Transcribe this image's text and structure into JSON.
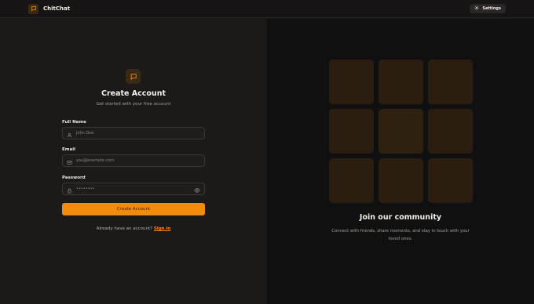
{
  "header": {
    "brand_name": "ChitChat",
    "settings_label": "Settings",
    "brand_icon": "chat-bubble-icon",
    "settings_icon": "gear-icon"
  },
  "form": {
    "title": "Create Account",
    "subtitle": "Get started with your free account",
    "fields": [
      {
        "label": "Full Name",
        "placeholder": "John Doe",
        "icon": "user-icon"
      },
      {
        "label": "Email",
        "placeholder": "you@example.com",
        "icon": "mail-icon"
      },
      {
        "label": "Password",
        "placeholder": "••••••••",
        "icon": "lock-icon",
        "trailing_icon": "eye-icon"
      }
    ],
    "submit_label": "Create Account",
    "signin_prompt": "Already have an account?",
    "signin_link": "Sign in"
  },
  "promo": {
    "title": "Join our community",
    "description": "Connect with friends, share moments, and stay in touch with your loved ones."
  },
  "colors": {
    "accent": "#f28a0c",
    "background_left": "#1c1a19",
    "background_right": "#111010",
    "tile": "#2b1e10"
  }
}
